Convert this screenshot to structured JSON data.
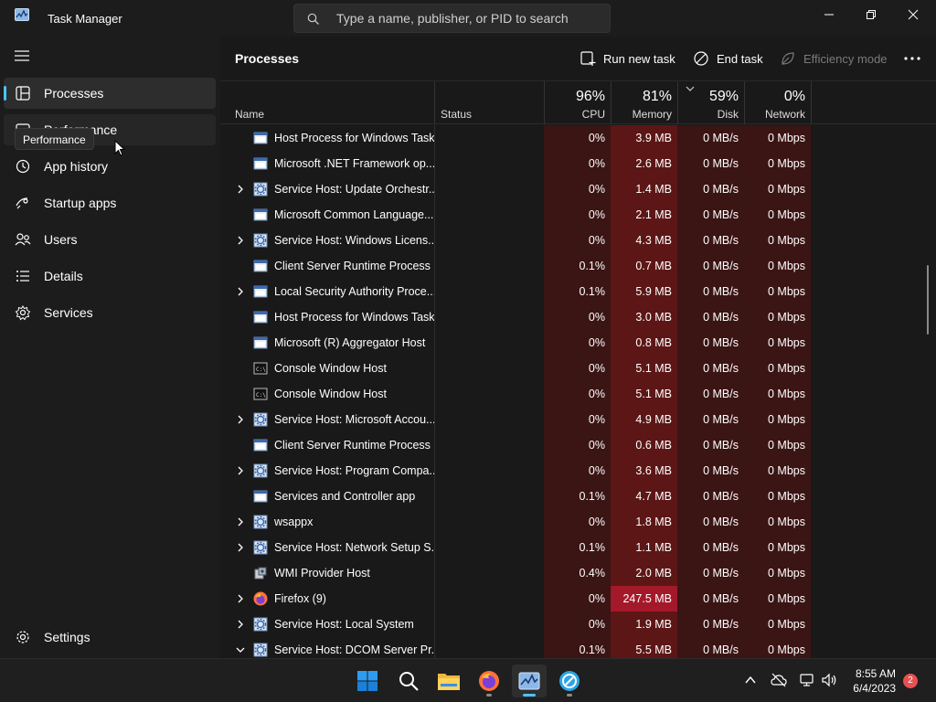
{
  "window": {
    "title": "Task Manager",
    "search_placeholder": "Type a name, publisher, or PID to search"
  },
  "sidebar": {
    "items": [
      {
        "label": "Processes",
        "icon": "processes-icon",
        "active": true
      },
      {
        "label": "Performance",
        "icon": "performance-icon"
      },
      {
        "label": "App history",
        "icon": "app-history-icon"
      },
      {
        "label": "Startup apps",
        "icon": "startup-apps-icon"
      },
      {
        "label": "Users",
        "icon": "users-icon"
      },
      {
        "label": "Details",
        "icon": "details-icon"
      },
      {
        "label": "Services",
        "icon": "services-icon"
      }
    ],
    "tooltip": "Performance",
    "settings_label": "Settings"
  },
  "toolbar": {
    "page_title": "Processes",
    "run_new_task": "Run new task",
    "end_task": "End task",
    "efficiency_mode": "Efficiency mode"
  },
  "columns": {
    "name": "Name",
    "status": "Status",
    "cpu_pct": "96%",
    "cpu_label": "CPU",
    "mem_pct": "81%",
    "mem_label": "Memory",
    "disk_pct": "59%",
    "disk_label": "Disk",
    "net_pct": "0%",
    "net_label": "Network"
  },
  "processes": [
    {
      "name": "Host Process for Windows Tasks",
      "icon": "window-icon",
      "expand": false,
      "cpu": "0%",
      "memory": "3.9 MB",
      "disk": "0 MB/s",
      "network": "0 Mbps"
    },
    {
      "name": "Microsoft .NET Framework op...",
      "icon": "window-icon",
      "expand": false,
      "cpu": "0%",
      "memory": "2.6 MB",
      "disk": "0 MB/s",
      "network": "0 Mbps"
    },
    {
      "name": "Service Host: Update Orchestr...",
      "icon": "service-icon",
      "expand": true,
      "cpu": "0%",
      "memory": "1.4 MB",
      "disk": "0 MB/s",
      "network": "0 Mbps"
    },
    {
      "name": "Microsoft Common Language...",
      "icon": "window-icon",
      "expand": false,
      "cpu": "0%",
      "memory": "2.1 MB",
      "disk": "0 MB/s",
      "network": "0 Mbps"
    },
    {
      "name": "Service Host: Windows Licens...",
      "icon": "service-icon",
      "expand": true,
      "cpu": "0%",
      "memory": "4.3 MB",
      "disk": "0 MB/s",
      "network": "0 Mbps"
    },
    {
      "name": "Client Server Runtime Process",
      "icon": "window-icon",
      "expand": false,
      "cpu": "0.1%",
      "memory": "0.7 MB",
      "disk": "0 MB/s",
      "network": "0 Mbps"
    },
    {
      "name": "Local Security Authority Proce...",
      "icon": "window-icon",
      "expand": true,
      "cpu": "0.1%",
      "memory": "5.9 MB",
      "disk": "0 MB/s",
      "network": "0 Mbps"
    },
    {
      "name": "Host Process for Windows Tasks",
      "icon": "window-icon",
      "expand": false,
      "cpu": "0%",
      "memory": "3.0 MB",
      "disk": "0 MB/s",
      "network": "0 Mbps"
    },
    {
      "name": "Microsoft (R) Aggregator Host",
      "icon": "window-icon",
      "expand": false,
      "cpu": "0%",
      "memory": "0.8 MB",
      "disk": "0 MB/s",
      "network": "0 Mbps"
    },
    {
      "name": "Console Window Host",
      "icon": "console-icon",
      "expand": false,
      "cpu": "0%",
      "memory": "5.1 MB",
      "disk": "0 MB/s",
      "network": "0 Mbps"
    },
    {
      "name": "Console Window Host",
      "icon": "console-icon",
      "expand": false,
      "cpu": "0%",
      "memory": "5.1 MB",
      "disk": "0 MB/s",
      "network": "0 Mbps"
    },
    {
      "name": "Service Host: Microsoft Accou...",
      "icon": "service-icon",
      "expand": true,
      "cpu": "0%",
      "memory": "4.9 MB",
      "disk": "0 MB/s",
      "network": "0 Mbps"
    },
    {
      "name": "Client Server Runtime Process",
      "icon": "window-icon",
      "expand": false,
      "cpu": "0%",
      "memory": "0.6 MB",
      "disk": "0 MB/s",
      "network": "0 Mbps"
    },
    {
      "name": "Service Host: Program Compa...",
      "icon": "service-icon",
      "expand": true,
      "cpu": "0%",
      "memory": "3.6 MB",
      "disk": "0 MB/s",
      "network": "0 Mbps"
    },
    {
      "name": "Services and Controller app",
      "icon": "window-icon",
      "expand": false,
      "cpu": "0.1%",
      "memory": "4.7 MB",
      "disk": "0 MB/s",
      "network": "0 Mbps"
    },
    {
      "name": "wsappx",
      "icon": "service-icon",
      "expand": true,
      "cpu": "0%",
      "memory": "1.8 MB",
      "disk": "0 MB/s",
      "network": "0 Mbps"
    },
    {
      "name": "Service Host: Network Setup S...",
      "icon": "service-icon",
      "expand": true,
      "cpu": "0.1%",
      "memory": "1.1 MB",
      "disk": "0 MB/s",
      "network": "0 Mbps"
    },
    {
      "name": "WMI Provider Host",
      "icon": "wmi-icon",
      "expand": false,
      "cpu": "0.4%",
      "memory": "2.0 MB",
      "disk": "0 MB/s",
      "network": "0 Mbps"
    },
    {
      "name": "Firefox (9)",
      "icon": "firefox-icon",
      "expand": true,
      "cpu": "0%",
      "memory": "247.5 MB",
      "memory_hot": true,
      "disk": "0 MB/s",
      "network": "0 Mbps"
    },
    {
      "name": "Service Host: Local System",
      "icon": "service-icon",
      "expand": true,
      "cpu": "0%",
      "memory": "1.9 MB",
      "disk": "0 MB/s",
      "network": "0 Mbps"
    },
    {
      "name": "Service Host: DCOM Server Pr...",
      "icon": "service-icon",
      "expand": true,
      "expanded": true,
      "cpu": "0.1%",
      "memory": "5.5 MB",
      "disk": "0 MB/s",
      "network": "0 Mbps"
    }
  ],
  "taskbar": {
    "time": "8:55 AM",
    "date": "6/4/2023",
    "notifications": "2",
    "apps": [
      "windows-start-icon",
      "search-icon",
      "file-explorer-icon",
      "firefox-icon",
      "task-manager-icon",
      "edge-icon"
    ]
  },
  "colors": {
    "accent": "#4cc2ff",
    "heat_low": "#3b1414",
    "heat_mid": "#5c1616",
    "heat_high": "#a3192a"
  }
}
